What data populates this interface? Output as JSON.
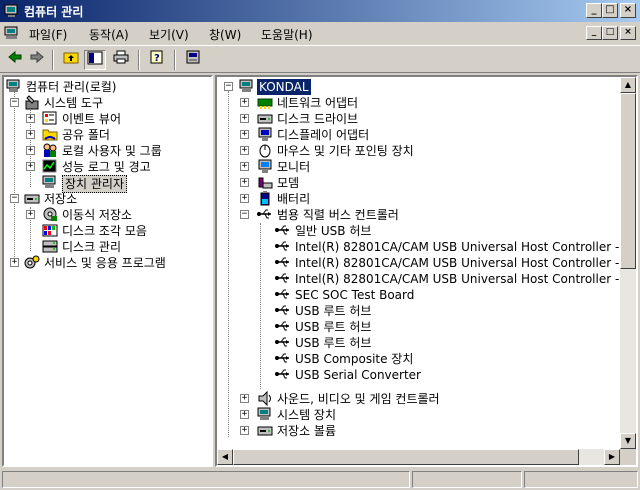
{
  "window": {
    "title": "컴퓨터 관리",
    "colors": {
      "titlebar": "#0a246a",
      "face": "#d4d0c8",
      "selection": "#0a246a"
    }
  },
  "window_buttons": {
    "minimize": "_",
    "maximize": "□",
    "close": "×"
  },
  "menu": [
    {
      "label": "파일(F)"
    },
    {
      "label": "동작(A)"
    },
    {
      "label": "보기(V)"
    },
    {
      "label": "창(W)"
    },
    {
      "label": "도움말(H)"
    }
  ],
  "toolbar_icons": [
    "back-arrow-icon",
    "forward-arrow-icon",
    "up-folder-icon",
    "show-hide-tree-icon",
    "print-icon",
    "help-icon",
    "properties-icon"
  ],
  "left_tree": [
    {
      "label": "컴퓨터 관리(로컬)",
      "icon": "computer-management-icon",
      "expander": "−"
    },
    {
      "label": "시스템 도구",
      "icon": "system-tools-icon",
      "expander": "−"
    },
    {
      "label": "이벤트 뷰어",
      "icon": "event-viewer-icon",
      "expander": "+"
    },
    {
      "label": "공유 폴더",
      "icon": "shared-folder-icon",
      "expander": "+"
    },
    {
      "label": "로컬 사용자 및 그룹",
      "icon": "users-icon",
      "expander": "+"
    },
    {
      "label": "성능 로그 및 경고",
      "icon": "performance-icon",
      "expander": "+"
    },
    {
      "label": "장치 관리자",
      "icon": "device-manager-icon",
      "expander": ""
    },
    {
      "label": "저장소",
      "icon": "storage-icon",
      "expander": "−"
    },
    {
      "label": "이동식 저장소",
      "icon": "removable-storage-icon",
      "expander": "+"
    },
    {
      "label": "디스크 조각 모음",
      "icon": "defrag-icon",
      "expander": ""
    },
    {
      "label": "디스크 관리",
      "icon": "disk-management-icon",
      "expander": ""
    },
    {
      "label": "서비스 및 응용 프로그램",
      "icon": "services-icon",
      "expander": "+"
    }
  ],
  "right_tree": [
    {
      "label": "KONDAL",
      "icon": "computer-icon",
      "expander": "−"
    },
    {
      "label": "네트워크 어댑터",
      "icon": "network-adapter-icon",
      "expander": "+"
    },
    {
      "label": "디스크 드라이브",
      "icon": "disk-drive-icon",
      "expander": "+"
    },
    {
      "label": "디스플레이 어댑터",
      "icon": "display-adapter-icon",
      "expander": "+"
    },
    {
      "label": "마우스 및 기타 포인팅 장치",
      "icon": "mouse-icon",
      "expander": "+"
    },
    {
      "label": "모니터",
      "icon": "monitor-icon",
      "expander": "+"
    },
    {
      "label": "모뎀",
      "icon": "modem-icon",
      "expander": "+"
    },
    {
      "label": "배터리",
      "icon": "battery-icon",
      "expander": "+"
    },
    {
      "label": "범용 직렬 버스 컨트롤러",
      "icon": "usb-icon",
      "expander": "−"
    },
    {
      "label": "일반 USB 허브",
      "icon": "usb-icon",
      "expander": ""
    },
    {
      "label": "Intel(R) 82801CA/CAM USB Universal Host Controller -",
      "icon": "usb-icon",
      "expander": ""
    },
    {
      "label": "Intel(R) 82801CA/CAM USB Universal Host Controller -",
      "icon": "usb-icon",
      "expander": ""
    },
    {
      "label": "Intel(R) 82801CA/CAM USB Universal Host Controller -",
      "icon": "usb-icon",
      "expander": ""
    },
    {
      "label": "SEC SOC Test Board",
      "icon": "usb-icon",
      "expander": ""
    },
    {
      "label": "USB 루트 허브",
      "icon": "usb-icon",
      "expander": ""
    },
    {
      "label": "USB 루트 허브",
      "icon": "usb-icon",
      "expander": ""
    },
    {
      "label": "USB 루트 허브",
      "icon": "usb-icon",
      "expander": ""
    },
    {
      "label": "USB Composite 장치",
      "icon": "usb-icon",
      "expander": ""
    },
    {
      "label": "USB Serial Converter",
      "icon": "usb-icon",
      "expander": ""
    },
    {
      "label": "사운드, 비디오 및 게임 컨트롤러",
      "icon": "sound-icon",
      "expander": "+"
    },
    {
      "label": "시스템 장치",
      "icon": "system-device-icon",
      "expander": "+"
    },
    {
      "label": "저장소 볼륨",
      "icon": "storage-volume-icon",
      "expander": "+"
    }
  ]
}
